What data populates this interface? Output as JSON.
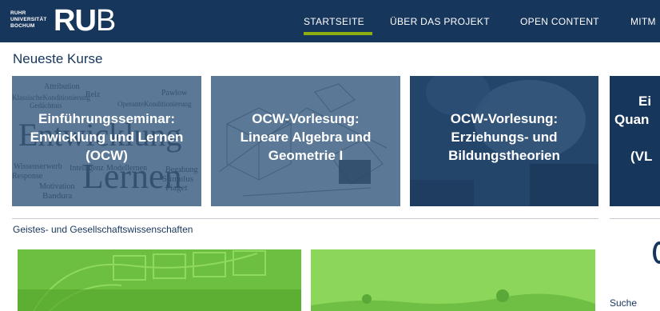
{
  "header": {
    "logo_small_lines": [
      "RUHR",
      "UNIVERSITÄT",
      "BOCHUM"
    ],
    "logo_bold": "RU",
    "logo_thin": "B",
    "nav": [
      {
        "label": "STARTSEITE",
        "active": true
      },
      {
        "label": "ÜBER DAS PROJEKT",
        "active": false
      },
      {
        "label": "OPEN CONTENT",
        "active": false
      },
      {
        "label": "MITM",
        "active": false
      }
    ]
  },
  "main": {
    "section_title": "Neueste Kurse",
    "courses": [
      {
        "lines": [
          "Einführungsseminar:",
          "Enwicklung und Lernen",
          "(OCW)"
        ]
      },
      {
        "lines": [
          "OCW-Vorlesung:",
          "Lineare Algebra und",
          "Geometrie I"
        ]
      },
      {
        "lines": [
          "OCW-Vorlesung:",
          "Erziehungs- und",
          "Bildungstheorien"
        ]
      },
      {
        "lines": [
          "Ei",
          "Quan",
          "",
          "(VL"
        ]
      }
    ],
    "wordcloud": [
      "Attribution",
      "Reiz",
      "Pawlow",
      "KlassischeKonditionierung",
      "OperanteKonditionierung",
      "Gedächtnis",
      "Entwicklung",
      "Wissenserwerb",
      "Intelligenz",
      "Modellernen",
      "Begabung",
      "Response",
      "Motivation",
      "Lernen",
      "Stimulus",
      "Bandura",
      "Piaget"
    ],
    "category": "Geistes- und Gesellschaftswissenschaften"
  },
  "sidebar": {
    "search_label": "Suche"
  },
  "colors": {
    "header_bg": "#17365c",
    "accent": "#8dae10",
    "tile_bg": "#5b7996"
  }
}
